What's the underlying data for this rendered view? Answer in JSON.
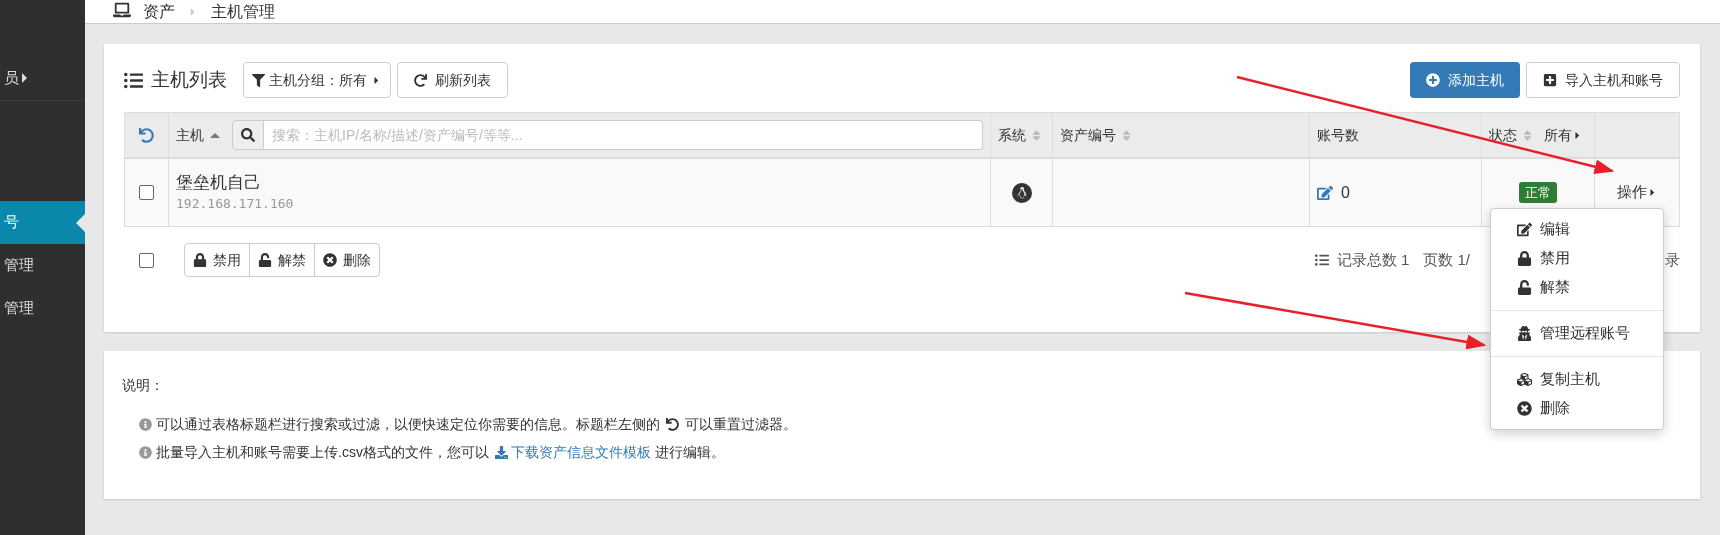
{
  "breadcrumb": [
    "资产",
    "主机管理"
  ],
  "sidebar": {
    "items": [
      {
        "label": "员",
        "expandable": true,
        "selected": false
      },
      {
        "label": "号",
        "expandable": false,
        "selected": true
      },
      {
        "label": "管理",
        "expandable": false,
        "selected": false
      },
      {
        "label": "管理",
        "expandable": false,
        "selected": false
      }
    ]
  },
  "toolbar": {
    "title": "主机列表",
    "group_filter": "主机分组：所有",
    "refresh": "刷新列表",
    "add": "添加主机",
    "import": "导入主机和账号"
  },
  "table": {
    "columns": [
      {
        "label": "主机"
      },
      {
        "label": "系统"
      },
      {
        "label": "资产编号"
      },
      {
        "label": "账号数"
      },
      {
        "label": "状态",
        "filter": "所有"
      }
    ],
    "search_placeholder": "搜索：主机IP/名称/描述/资产编号/等等...",
    "rows": [
      {
        "name": "堡垒机自己",
        "ip": "192.168.171.160",
        "checked": false,
        "accounts": "0",
        "status": "正常",
        "action": "操作"
      }
    ]
  },
  "bulk": {
    "checked": false,
    "buttons": [
      "禁用",
      "解禁",
      "删除"
    ]
  },
  "pagination": [
    "记录总数 1",
    "页数 1/",
    "录"
  ],
  "menu": {
    "items": [
      {
        "kind": "item",
        "label": "编辑"
      },
      {
        "kind": "item",
        "label": "禁用"
      },
      {
        "kind": "item",
        "label": "解禁"
      },
      {
        "kind": "divider"
      },
      {
        "kind": "item",
        "label": "管理远程账号"
      },
      {
        "kind": "divider"
      },
      {
        "kind": "item",
        "label": "复制主机"
      },
      {
        "kind": "item",
        "label": "删除"
      }
    ]
  },
  "notes": {
    "title": "说明：",
    "items": [
      {
        "text": "可以通过表格标题栏进行搜索或过滤，以便快速定位你需要的信息。标题栏左侧的",
        "after": "可以重置过滤器。"
      },
      {
        "text": "批量导入主机和账号需要上传.csv格式的文件，您可以",
        "link": "下载资产信息文件模板",
        "after": "进行编辑。"
      }
    ]
  }
}
